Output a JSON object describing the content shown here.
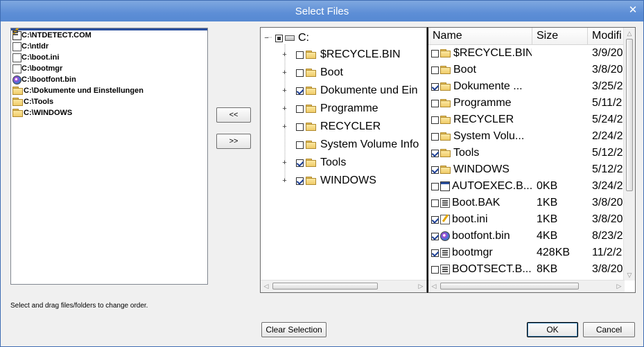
{
  "window": {
    "title": "Select Files",
    "close_symbol": "✕"
  },
  "order_list": {
    "items": [
      {
        "label": "C:\\NTDETECT.COM",
        "icon": "window-file-icon"
      },
      {
        "label": "C:\\ntldr",
        "icon": "system-file-icon"
      },
      {
        "label": "C:\\boot.ini",
        "icon": "notepad-file-icon"
      },
      {
        "label": "C:\\bootmgr",
        "icon": "system-file-icon"
      },
      {
        "label": "C:\\bootfont.bin",
        "icon": "font-file-icon"
      },
      {
        "label": "C:\\Dokumente und Einstellungen",
        "icon": "folder-icon"
      },
      {
        "label": "C:\\Tools",
        "icon": "folder-icon"
      },
      {
        "label": "C:\\WINDOWS",
        "icon": "folder-icon"
      }
    ]
  },
  "move_buttons": {
    "up_label": "<<",
    "down_label": ">>"
  },
  "tree": {
    "root_label": "C:",
    "root_state": "partial",
    "nodes": [
      {
        "label": "$RECYCLE.BIN",
        "checked": false,
        "expandable": true
      },
      {
        "label": "Boot",
        "checked": false,
        "expandable": true
      },
      {
        "label": "Dokumente und Ein",
        "checked": true,
        "expandable": true
      },
      {
        "label": "Programme",
        "checked": false,
        "expandable": true
      },
      {
        "label": "RECYCLER",
        "checked": false,
        "expandable": true
      },
      {
        "label": "System Volume Info",
        "checked": false,
        "expandable": false
      },
      {
        "label": "Tools",
        "checked": true,
        "expandable": true
      },
      {
        "label": "WINDOWS",
        "checked": true,
        "expandable": true
      }
    ]
  },
  "file_list": {
    "columns": {
      "name": "Name",
      "size": "Size",
      "modified": "Modifi"
    },
    "rows": [
      {
        "name": "$RECYCLE.BIN",
        "size": "",
        "modified": "3/9/20",
        "checked": false,
        "icon": "folder-icon"
      },
      {
        "name": "Boot",
        "size": "",
        "modified": "3/8/20",
        "checked": false,
        "icon": "folder-icon"
      },
      {
        "name": "Dokumente ...",
        "size": "",
        "modified": "3/25/2",
        "checked": true,
        "icon": "folder-icon"
      },
      {
        "name": "Programme",
        "size": "",
        "modified": "5/11/2",
        "checked": false,
        "icon": "folder-icon"
      },
      {
        "name": "RECYCLER",
        "size": "",
        "modified": "5/24/2",
        "checked": false,
        "icon": "folder-icon"
      },
      {
        "name": "System Volu...",
        "size": "",
        "modified": "2/24/2",
        "checked": false,
        "icon": "folder-icon"
      },
      {
        "name": "Tools",
        "size": "",
        "modified": "5/12/2",
        "checked": true,
        "icon": "folder-icon"
      },
      {
        "name": "WINDOWS",
        "size": "",
        "modified": "5/12/2",
        "checked": true,
        "icon": "folder-icon"
      },
      {
        "name": "AUTOEXEC.B...",
        "size": "0KB",
        "modified": "3/24/2",
        "checked": false,
        "icon": "window-file-icon"
      },
      {
        "name": "Boot.BAK",
        "size": "1KB",
        "modified": "3/8/20",
        "checked": false,
        "icon": "system-file-icon"
      },
      {
        "name": "boot.ini",
        "size": "1KB",
        "modified": "3/8/20",
        "checked": true,
        "icon": "notepad-file-icon"
      },
      {
        "name": "bootfont.bin",
        "size": "4KB",
        "modified": "8/23/2",
        "checked": true,
        "icon": "font-file-icon"
      },
      {
        "name": "bootmgr",
        "size": "428KB",
        "modified": "11/2/2",
        "checked": true,
        "icon": "system-file-icon"
      },
      {
        "name": "BOOTSECT.B...",
        "size": "8KB",
        "modified": "3/8/20",
        "checked": false,
        "icon": "system-file-icon"
      }
    ]
  },
  "hint": "Select and drag files/folders to change order.",
  "buttons": {
    "clear": "Clear Selection",
    "ok": "OK",
    "cancel": "Cancel"
  }
}
